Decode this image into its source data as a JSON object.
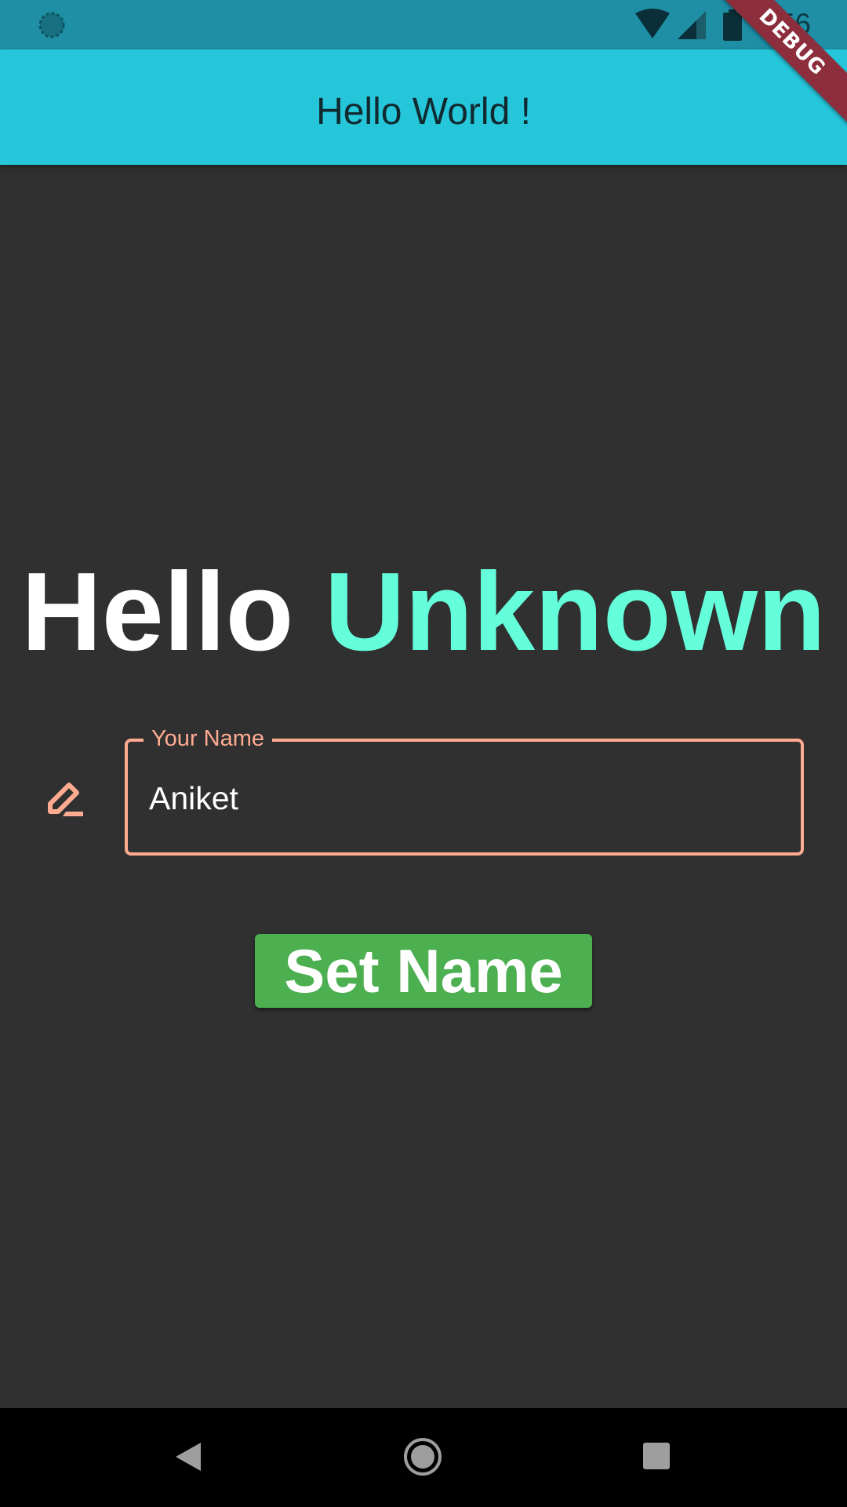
{
  "status_bar": {
    "time": "6:56",
    "icons": [
      "sync-icon",
      "wifi-icon",
      "signal-icon",
      "battery-icon"
    ]
  },
  "app_bar": {
    "title": "Hello World !"
  },
  "debug_banner": {
    "label": "DEBUG"
  },
  "greeting": {
    "hello": "Hello",
    "name": "Unknown"
  },
  "name_field": {
    "label": "Your Name",
    "value": "Aniket",
    "icon": "edit-icon"
  },
  "set_name_button": {
    "label": "Set Name"
  },
  "nav_bar": {
    "icons": [
      "back-icon",
      "home-icon",
      "recents-icon"
    ]
  },
  "colors": {
    "status_bar": "#1e8fa5",
    "app_bar": "#26c6da",
    "background": "#303030",
    "accent_name": "#64ffda",
    "field_border": "#ffab91",
    "button": "#4caf50",
    "debug_banner": "#8c2e3c"
  }
}
